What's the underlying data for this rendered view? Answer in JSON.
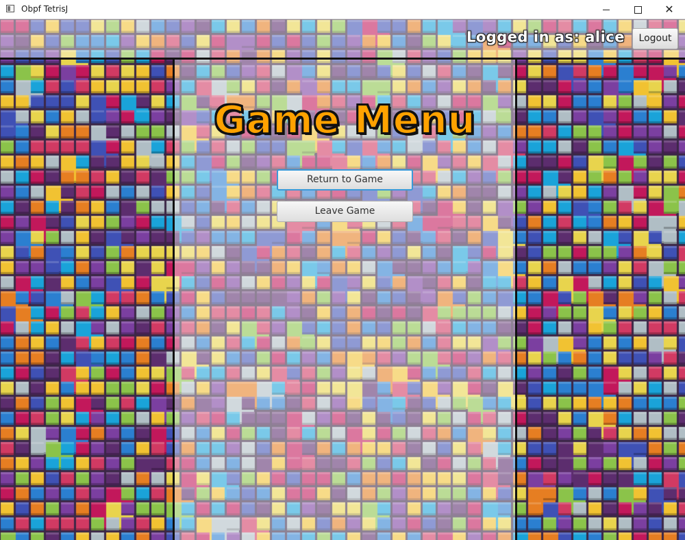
{
  "window": {
    "title": "Obpf TetrisJ",
    "controls": [
      "minimize",
      "maximize",
      "close"
    ],
    "icon": "app-window-icon"
  },
  "header": {
    "logged_in_text": "Logged in as: alice",
    "logout_label": "Logout"
  },
  "menu": {
    "title": "Game Menu",
    "return_label": "Return to Game",
    "leave_label": "Leave Game",
    "focused_button": "Return to Game"
  },
  "colors": {
    "title_orange": "#ffa200",
    "focus_blue": "#3a9ad9",
    "tile_palette": [
      "#d13a63",
      "#2b7fd0",
      "#f1c232",
      "#7b3fa0",
      "#e67e22",
      "#1aa3d9",
      "#8bc34a",
      "#c2185b",
      "#3f51b5",
      "#e8d44d",
      "#b0bec5",
      "#5c2d6e"
    ]
  }
}
